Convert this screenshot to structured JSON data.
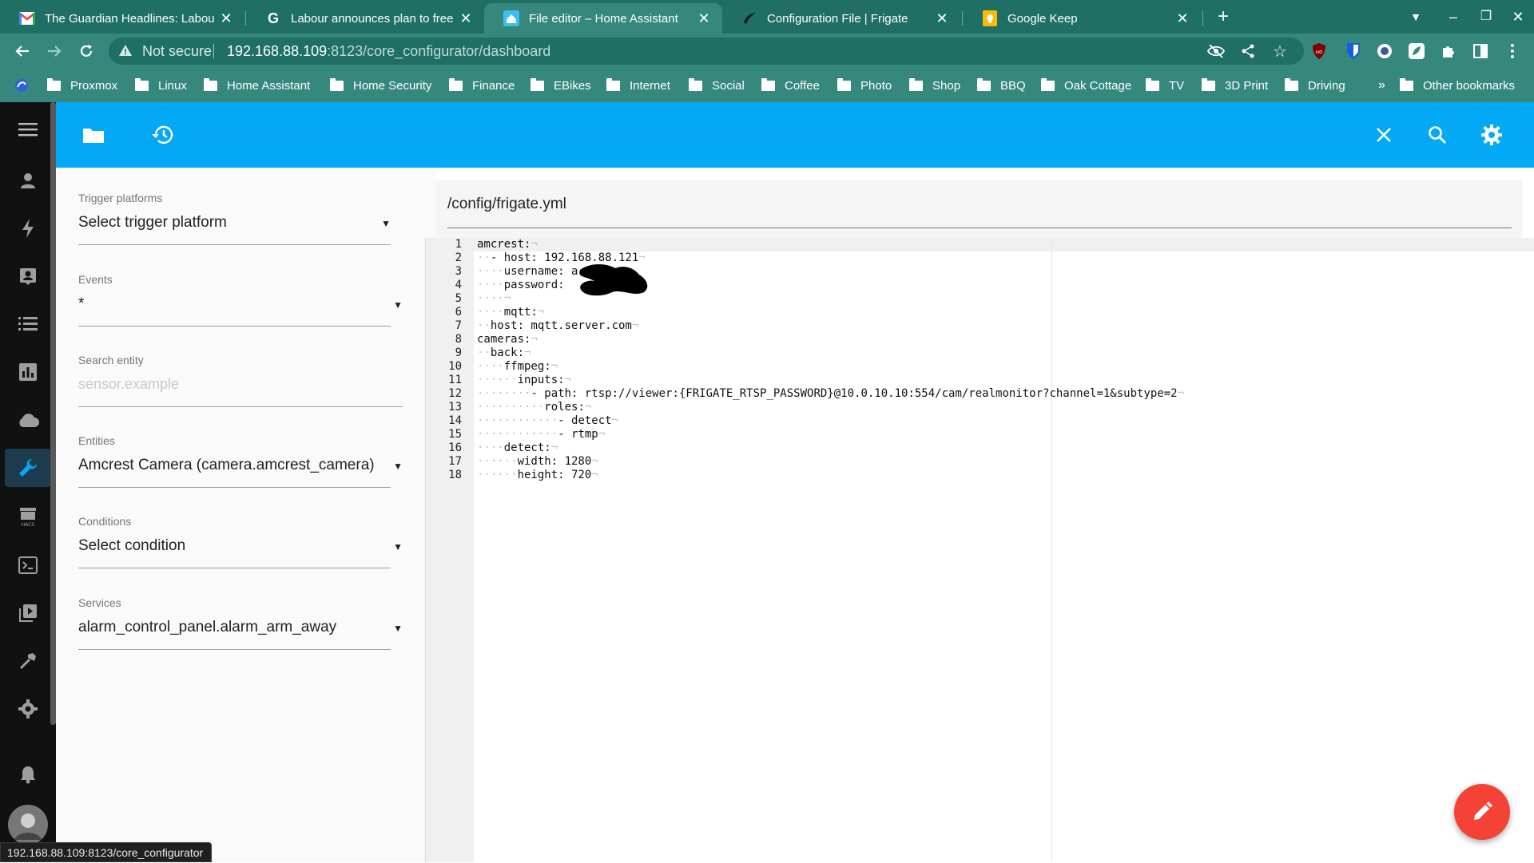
{
  "browser": {
    "tabs": [
      {
        "title": "The Guardian Headlines: Labour",
        "icon": "gmail-icon"
      },
      {
        "title": "Labour announces plan to freeze",
        "icon": "google-icon"
      },
      {
        "title": "File editor – Home Assistant",
        "icon": "home-assistant-icon"
      },
      {
        "title": "Configuration File | Frigate",
        "icon": "frigate-icon"
      },
      {
        "title": "Google Keep",
        "icon": "google-keep-icon"
      }
    ],
    "active_tab": 2,
    "omnibox": {
      "security": "Not secure",
      "url_host": "192.168.88.109",
      "url_rest": ":8123/core_configurator/dashboard"
    },
    "bookmarks": [
      "Proxmox",
      "Linux",
      "Home Assistant",
      "Home Security",
      "Finance",
      "EBikes",
      "Internet",
      "Social",
      "Coffee",
      "Photo",
      "Shop",
      "BBQ",
      "Oak Cottage",
      "TV",
      "3D Print",
      "Driving"
    ],
    "overflow_label": "»",
    "other_bookmarks": "Other bookmarks",
    "status_url": "192.168.88.109:8123/core_configurator"
  },
  "form": {
    "trigger": {
      "label": "Trigger platforms",
      "value": "Select trigger platform"
    },
    "events": {
      "label": "Events",
      "value": "*"
    },
    "search": {
      "label": "Search entity",
      "placeholder": "sensor.example"
    },
    "entities": {
      "label": "Entities",
      "value": "Amcrest Camera (camera.amcrest_camera)"
    },
    "conditions": {
      "label": "Conditions",
      "value": "Select condition"
    },
    "services": {
      "label": "Services",
      "value": "alarm_control_panel.alarm_arm_away"
    }
  },
  "editor": {
    "file_path": "/config/frigate.yml",
    "lines": [
      {
        "n": "1",
        "ind": "",
        "text": "amcrest:",
        "eol": true
      },
      {
        "n": "2",
        "ind": "··",
        "text": "- host: 192.168.88.121",
        "eol": true
      },
      {
        "n": "3",
        "ind": "····",
        "text": "username: a",
        "eol": false
      },
      {
        "n": "4",
        "ind": "····",
        "text": "password: ",
        "eol": false
      },
      {
        "n": "5",
        "ind": "····",
        "text": "",
        "eol": true
      },
      {
        "n": "6",
        "ind": "····",
        "text": "mqtt:",
        "eol": true
      },
      {
        "n": "7",
        "ind": "··",
        "text": "host: mqtt.server.com",
        "eol": true
      },
      {
        "n": "8",
        "ind": "",
        "text": "cameras:",
        "eol": true
      },
      {
        "n": "9",
        "ind": "··",
        "text": "back:",
        "eol": true
      },
      {
        "n": "10",
        "ind": "····",
        "text": "ffmpeg:",
        "eol": true
      },
      {
        "n": "11",
        "ind": "······",
        "text": "inputs:",
        "eol": true
      },
      {
        "n": "12",
        "ind": "········",
        "text": "- path: rtsp://viewer:{FRIGATE_RTSP_PASSWORD}@10.0.10.10:554/cam/realmonitor?channel=1&subtype=2",
        "eol": true
      },
      {
        "n": "13",
        "ind": "··········",
        "text": "roles:",
        "eol": true
      },
      {
        "n": "14",
        "ind": "············",
        "text": "- detect",
        "eol": true
      },
      {
        "n": "15",
        "ind": "············",
        "text": "- rtmp",
        "eol": true
      },
      {
        "n": "16",
        "ind": "····",
        "text": "detect:",
        "eol": true
      },
      {
        "n": "17",
        "ind": "······",
        "text": "width: 1280",
        "eol": true
      },
      {
        "n": "18",
        "ind": "······",
        "text": "height: 720",
        "eol": true
      }
    ],
    "eol_mark": "¬"
  },
  "colors": {
    "ha_primary": "#03a9f4",
    "chrome_frame": "#1f6f64",
    "chrome_toolbar": "#35887b",
    "fab": "#f44336",
    "sidebar": "#111111"
  }
}
